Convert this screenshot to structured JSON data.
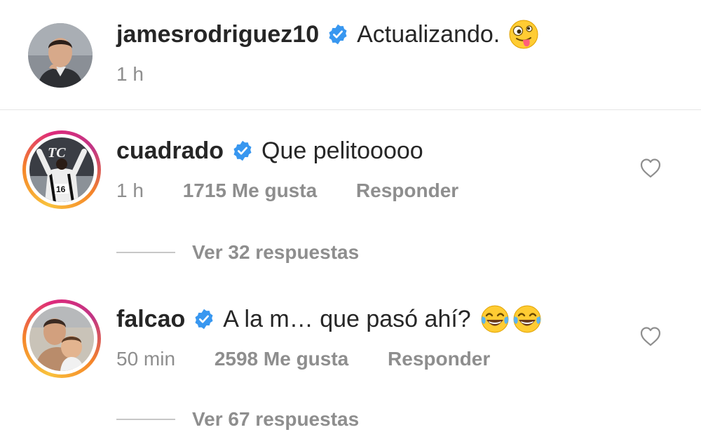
{
  "caption": {
    "username": "jamesrodriguez10",
    "text": "Actualizando.",
    "emoji": "zany-face",
    "time": "1 h"
  },
  "comments": [
    {
      "username": "cuadrado",
      "text": "Que pelitooooo",
      "time": "1 h",
      "likes": "1715 Me gusta",
      "reply_label": "Responder",
      "view_replies": "Ver 32 respuestas"
    },
    {
      "username": "falcao",
      "text": "A la m… que pasó ahí?",
      "emojis": [
        "face-with-tears-of-joy",
        "face-with-tears-of-joy"
      ],
      "time": "50 min",
      "likes": "2598 Me gusta",
      "reply_label": "Responder",
      "view_replies": "Ver 67 respuestas"
    }
  ],
  "colors": {
    "verified": "#3897f0",
    "secondary_text": "#8e8e8e",
    "primary_text": "#262626",
    "story_ring": [
      "#f9c23c",
      "#f58529",
      "#dd2a7b",
      "#c13584"
    ]
  }
}
